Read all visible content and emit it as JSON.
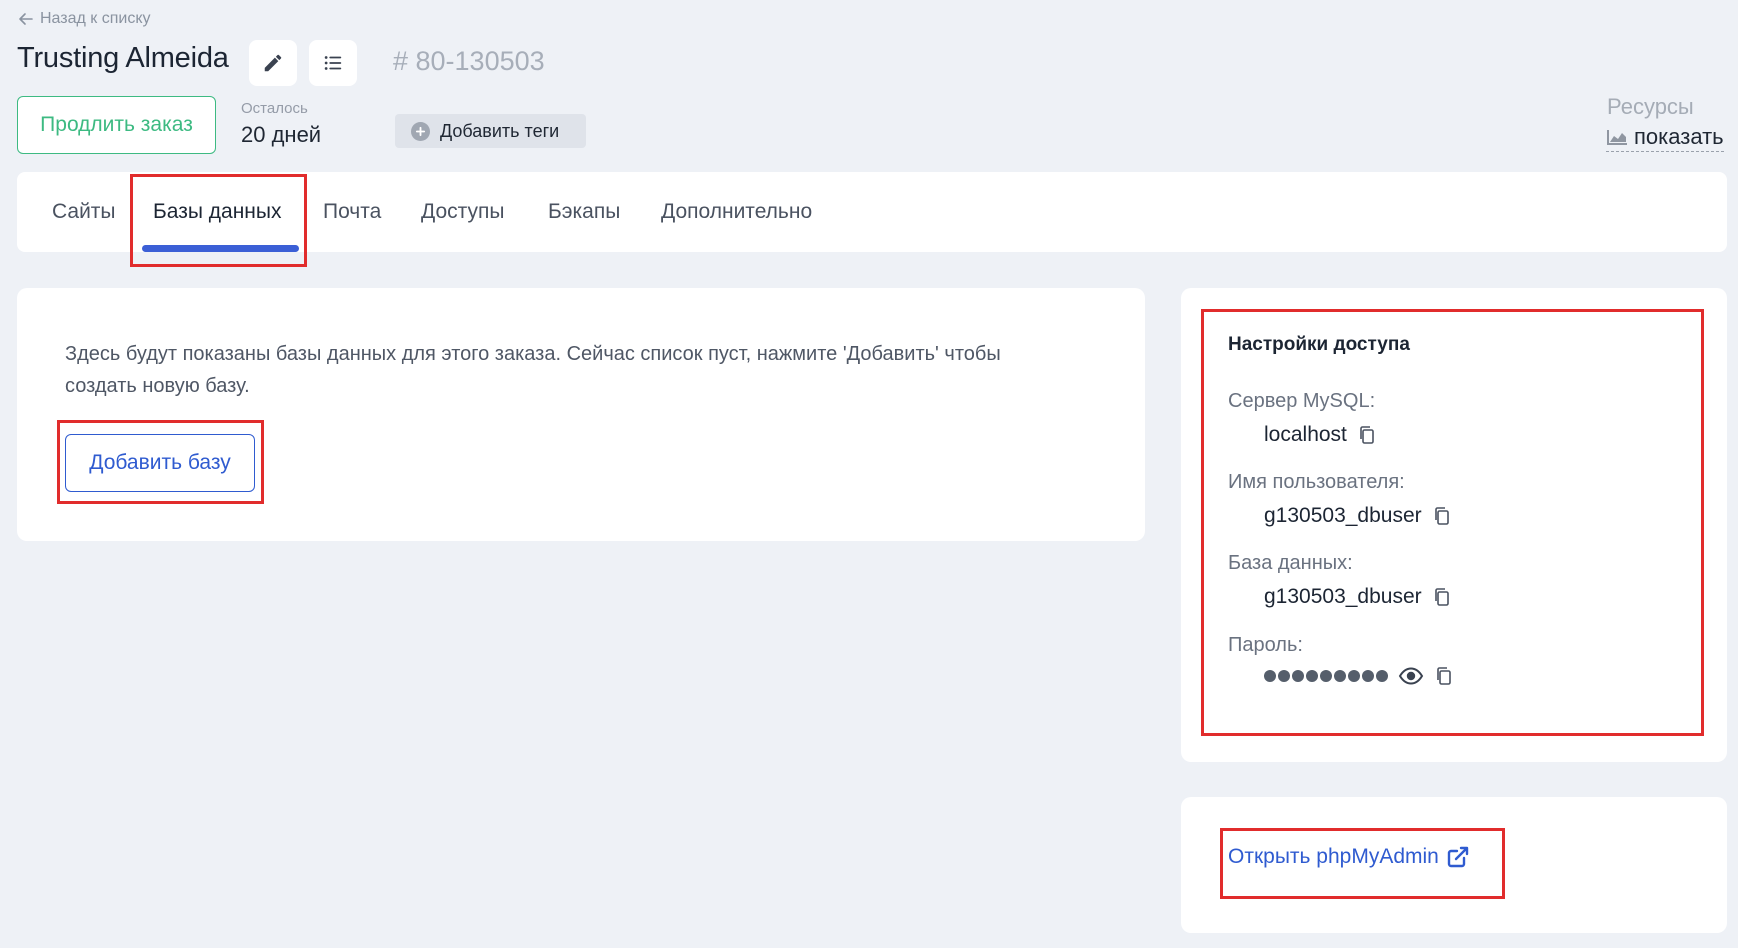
{
  "header": {
    "back_label": "Назад к списку",
    "title": "Trusting Almeida",
    "order_id": "# 80-130503",
    "renew_label": "Продлить заказ",
    "remaining_label": "Осталось",
    "remaining_value": "20 дней",
    "add_tags_label": "Добавить теги",
    "resources_label": "Ресурсы",
    "resources_show_label": "показать"
  },
  "tabs": [
    {
      "label": "Сайты",
      "active": false
    },
    {
      "label": "Базы данных",
      "active": true
    },
    {
      "label": "Почта",
      "active": false
    },
    {
      "label": "Доступы",
      "active": false
    },
    {
      "label": "Бэкапы",
      "active": false
    },
    {
      "label": "Дополнительно",
      "active": false
    }
  ],
  "databases": {
    "empty_text": "Здесь будут показаны базы данных для этого заказа. Сейчас список пуст, нажмите 'Добавить' чтобы создать новую базу.",
    "add_button_label": "Добавить базу"
  },
  "access": {
    "title": "Настройки доступа",
    "server_label": "Сервер MySQL:",
    "server_value": "localhost",
    "user_label": "Имя пользователя:",
    "user_value": "g130503_dbuser",
    "db_label": "База данных:",
    "db_value": "g130503_dbuser",
    "password_label": "Пароль:",
    "password_masked_length": 9
  },
  "phpmyadmin": {
    "link_label": "Открыть phpMyAdmin"
  },
  "colors": {
    "accent_blue": "#2f5bd0",
    "tab_underline": "#3b5fd6",
    "renew_green": "#3dba82",
    "annotation_red": "#e12c2c",
    "page_background": "#eef1f6"
  },
  "icons": [
    "arrow-left-icon",
    "pencil-icon",
    "list-icon",
    "plus-circle-icon",
    "chart-icon",
    "copy-icon",
    "eye-icon",
    "external-link-icon"
  ]
}
